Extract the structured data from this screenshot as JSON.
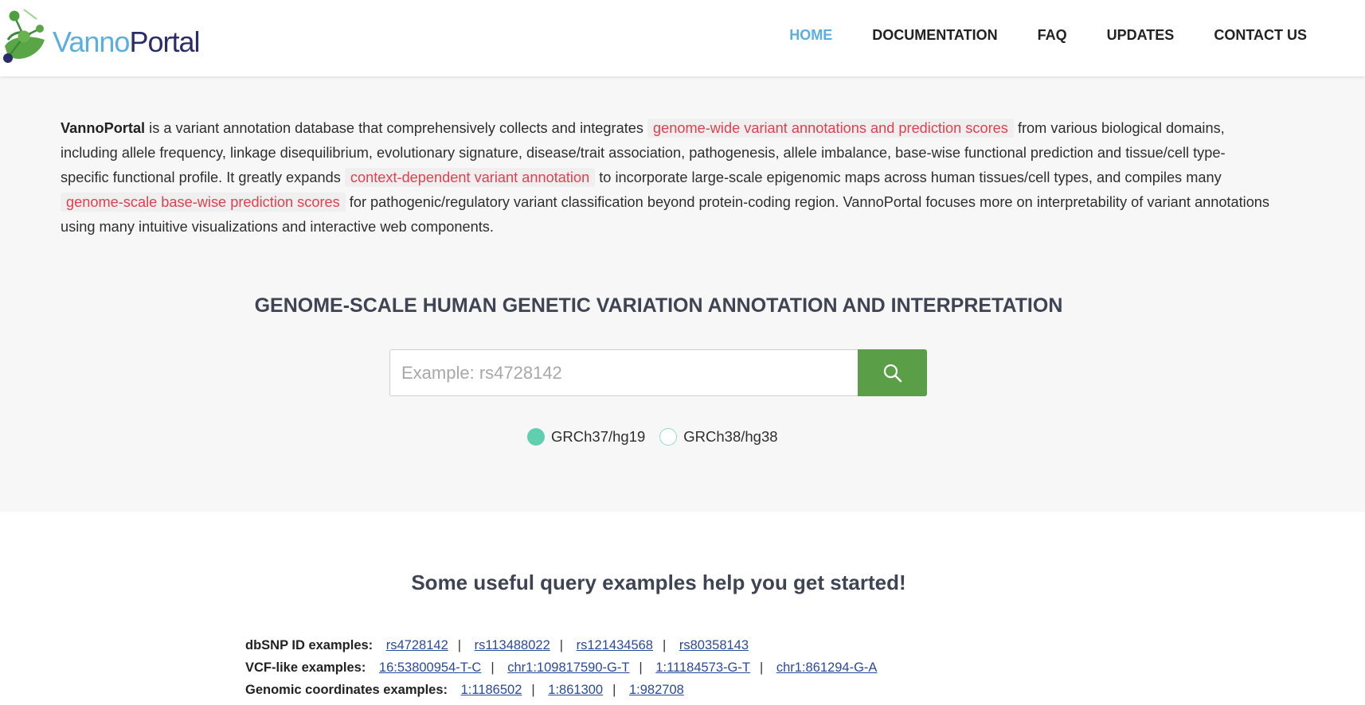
{
  "brand": {
    "part1": "Vanno",
    "part2": "Portal"
  },
  "nav": [
    {
      "label": "HOME",
      "active": true
    },
    {
      "label": "DOCUMENTATION",
      "active": false
    },
    {
      "label": "FAQ",
      "active": false
    },
    {
      "label": "UPDATES",
      "active": false
    },
    {
      "label": "CONTACT US",
      "active": false
    }
  ],
  "intro": {
    "brand": "VannoPortal",
    "t1": " is a variant annotation database that comprehensively collects and integrates ",
    "h1": "genome-wide variant annotations and prediction scores",
    "t2": " from various biological domains, including allele frequency, linkage disequilibrium, evolutionary signature, disease/trait association, pathogenesis, allele imbalance, base-wise functional prediction and tissue/cell type-specific functional profile. It greatly expands ",
    "h2": "context-dependent variant annotation",
    "t3": " to incorporate large-scale epigenomic maps across human tissues/cell types, and compiles many ",
    "h3": "genome-scale base-wise prediction scores",
    "t4": " for pathogenic/regulatory variant classification beyond protein-coding region. VannoPortal focuses more on interpretability of variant annotations using many intuitive visualizations and interactive web components."
  },
  "headline": "GENOME-SCALE HUMAN GENETIC VARIATION ANNOTATION AND INTERPRETATION",
  "search": {
    "placeholder": "Example: rs4728142",
    "value": ""
  },
  "assembly": {
    "options": [
      {
        "label": "GRCh37/hg19",
        "selected": true
      },
      {
        "label": "GRCh38/hg38",
        "selected": false
      }
    ]
  },
  "examples": {
    "title": "Some useful query examples help you get started!",
    "rows": [
      {
        "label": "dbSNP ID examples:",
        "items": [
          "rs4728142",
          "rs113488022",
          "rs121434568",
          "rs80358143"
        ]
      },
      {
        "label": "VCF-like examples:",
        "items": [
          "16:53800954-T-C",
          "chr1:109817590-G-T",
          "1:11184573-G-T",
          "chr1:861294-G-A"
        ]
      },
      {
        "label": "Genomic coordinates examples:",
        "items": [
          "1:1186502",
          "1:861300",
          "1:982708"
        ]
      }
    ]
  },
  "separator": "|",
  "colors": {
    "accent": "#5aaee0",
    "search_button": "#5a9e48",
    "highlight_text": "#e0404f",
    "radio": "#5fcfb0"
  }
}
